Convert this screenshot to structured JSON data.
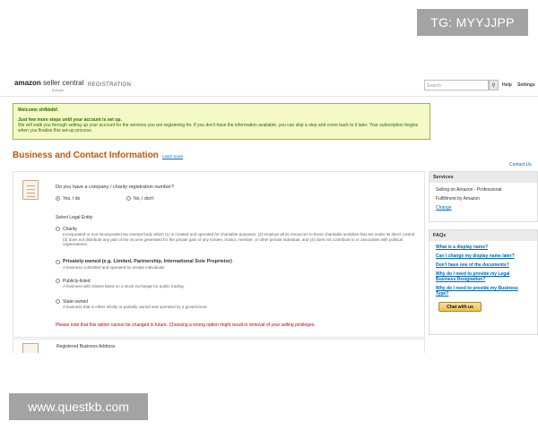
{
  "watermarks": {
    "top": "TG: MYYJJPP",
    "bottom": "www.questkb.com"
  },
  "header": {
    "logo_main": "amazon",
    "logo_sc": "seller central",
    "logo_sub": "Europe",
    "section": "REGISTRATION",
    "search_placeholder": "Search",
    "help": "Help",
    "settings": "Settings"
  },
  "welcome": {
    "title": "Welcome shfkkdkf.",
    "line1": "Just few more steps until your account is set up.",
    "line2": "We will walk you through setting up your account for the services you are registering for. If you don't have the information available, you can skip a step and come back to it later. Your subscription begins when you finalise this set-up process."
  },
  "page": {
    "title": "Business and Contact Information",
    "learn_more": "Learn more",
    "contact_us": "Contact Us"
  },
  "form": {
    "question": "Do you have a company / charity registration number?",
    "yes_label": "Yes, I do",
    "no_label": "No, I don't",
    "select_entity": "Select Legal Entity",
    "options": [
      {
        "title": "Charity",
        "desc": "Incorporated or non-incorporated tax exempt body which (1) is created and operated for charitable purposes, (2) employs all its resources to those charitable activities that are under its direct control, (3) does not distribute any part of the income generated for the private gain of any trustee, trustor, member, or other private individual, and (4) does not contribute to or associates with political organisations."
      },
      {
        "title": "Privately-owned (e.g. Limited, Partnership, International Sole Proprietor)",
        "desc": "A business controlled and operated by private individuals"
      },
      {
        "title": "Publicly-listed",
        "desc": "A business with shares listed on a stock exchange for public trading."
      },
      {
        "title": "State-owned",
        "desc": "A business that is either wholly or partially owned and operated by a government."
      }
    ],
    "warning": "Please note that this option cannot be changed in future. Choosing a wrong option might result in removal of your selling privileges.",
    "next_section": "Registered Business Address"
  },
  "services": {
    "heading": "Services",
    "items": [
      "Selling on Amazon - Professional",
      "Fulfillment by Amazon"
    ],
    "change": "Change"
  },
  "faqs": {
    "heading": "FAQs",
    "items": [
      "What is a display name?",
      "Can I change my display name later?",
      "Don't have one of the documents?",
      "Why do I need to provide my Legal Business Designation?",
      "Why do I need to provide my Business Type?"
    ],
    "chat": "Chat with us"
  }
}
